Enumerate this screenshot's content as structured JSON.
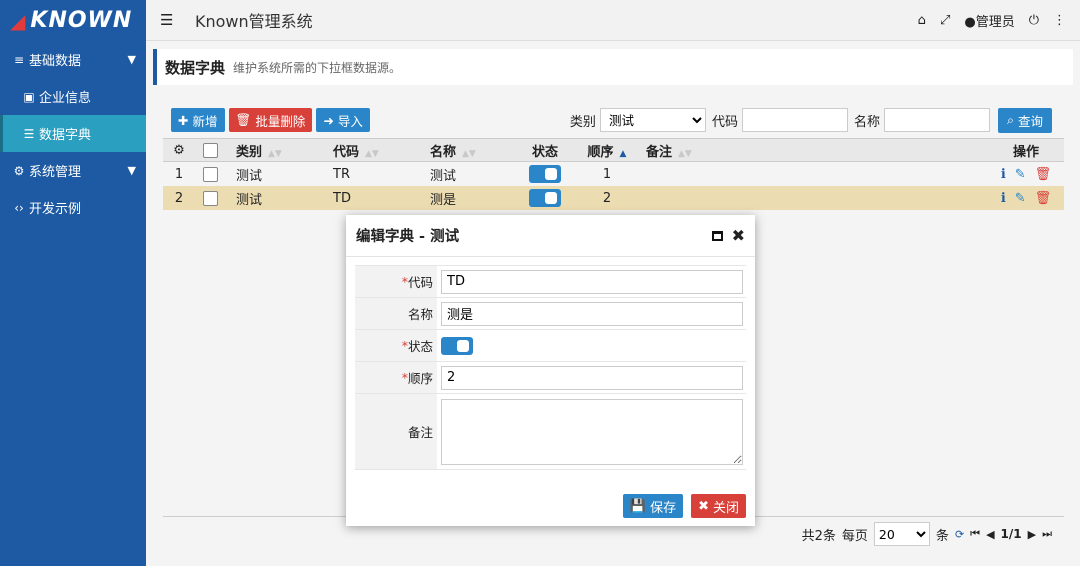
{
  "sidebar": {
    "logo": "KNOWN",
    "items": [
      {
        "label": "基础数据",
        "icon": "database-icon"
      },
      {
        "label": "企业信息",
        "icon": "id-card-icon"
      },
      {
        "label": "数据字典",
        "icon": "list-icon"
      },
      {
        "label": "系统管理",
        "icon": "gears-icon"
      },
      {
        "label": "开发示例",
        "icon": "code-icon"
      }
    ]
  },
  "topbar": {
    "title": "Known管理系统",
    "user": "管理员"
  },
  "page": {
    "title": "数据字典",
    "description": "维护系统所需的下拉框数据源。"
  },
  "toolbar": {
    "add": "新增",
    "batch_delete": "批量删除",
    "import": "导入",
    "category_label": "类别",
    "category_value": "测试",
    "code_label": "代码",
    "code_value": "",
    "name_label": "名称",
    "name_value": "",
    "search": "查询"
  },
  "table": {
    "headers": [
      "类别",
      "代码",
      "名称",
      "状态",
      "顺序",
      "备注",
      "操作"
    ],
    "rows": [
      {
        "no": "1",
        "category": "测试",
        "code": "TR",
        "name": "测试",
        "enabled": true,
        "order": "1",
        "note": ""
      },
      {
        "no": "2",
        "category": "测试",
        "code": "TD",
        "name": "测是",
        "enabled": true,
        "order": "2",
        "note": ""
      }
    ]
  },
  "pager": {
    "total": "共2条",
    "per_page_label": "每页",
    "per_page": "20",
    "unit": "条",
    "page": "1/1"
  },
  "modal": {
    "title": "编辑字典 - 测试",
    "fields": {
      "code_label": "代码",
      "code_value": "TD",
      "name_label": "名称",
      "name_value": "测是",
      "status_label": "状态",
      "status_value": true,
      "order_label": "顺序",
      "order_value": "2",
      "note_label": "备注",
      "note_value": ""
    },
    "save": "保存",
    "close": "关闭"
  },
  "colors": {
    "sidebar": "#1d5aa3",
    "active_item": "#2a9fc0",
    "primary": "#2a86c8",
    "danger": "#d8403a",
    "selected_row": "#ecdcb1"
  }
}
